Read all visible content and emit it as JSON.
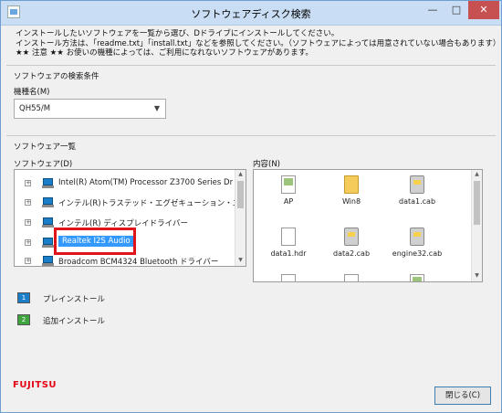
{
  "window": {
    "title": "ソフトウェアディスク検索",
    "minimize": "—",
    "maximize": "□",
    "close": "✕"
  },
  "intro": [
    "インストールしたいソフトウェアを一覧から選び、Dドライブにインストールしてください。",
    "インストール方法は、「readme.txt」「install.txt」などを参照してください。（ソフトウェアによっては用意されていない場合もあります）",
    "★★ 注意 ★★ お使いの機種によっては、ご利用になれないソフトウェアがあります。"
  ],
  "search": {
    "section_title": "ソフトウェアの検索条件",
    "model_label": "機種名(M)",
    "model_value": "QH55/M",
    "arrow": "▼"
  },
  "software_list": {
    "section_title": "ソフトウェア一覧",
    "tree_label": "ソフトウェア(D)",
    "items": [
      "Intel(R) Atom(TM) Processor Z3700 Series Dr",
      "インテル(R)トラステッド・エグゼキューション・エン",
      "インテル(R) ディスプレイドライバー",
      "Realtek I2S Audio",
      "Broadcom BCM4324 Bluetooth ドライバー"
    ],
    "selected_index": 3
  },
  "contents": {
    "label": "内容(N)",
    "files": [
      {
        "name": "AP",
        "icon": "app-icon"
      },
      {
        "name": "Win8",
        "icon": "folder-icon"
      },
      {
        "name": "data1.cab",
        "icon": "cab-icon"
      },
      {
        "name": "data1.hdr",
        "icon": "doc-icon"
      },
      {
        "name": "data2.cab",
        "icon": "cab-icon"
      },
      {
        "name": "engine32.cab",
        "icon": "cab-icon"
      }
    ]
  },
  "install": {
    "pre_install_label": "プレインストール",
    "pre_install_icon": "1",
    "add_install_label": "追加インストール",
    "add_install_icon": "2"
  },
  "footer": {
    "logo": "FUJITSU",
    "close_button": "閉じる(C)"
  },
  "colors": {
    "selection": "#3399ff",
    "highlight_border": "#e0141b",
    "brand_red": "#e60012"
  }
}
